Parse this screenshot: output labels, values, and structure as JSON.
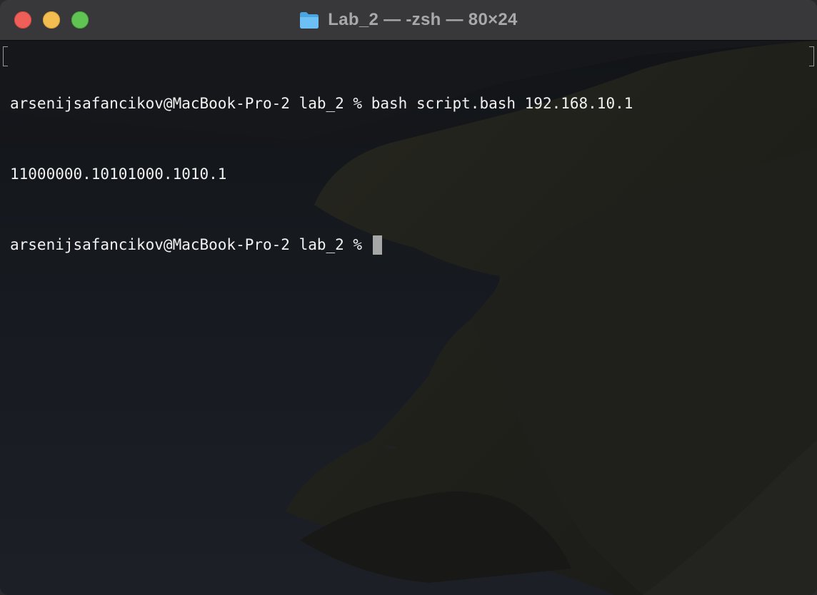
{
  "window": {
    "title": "Lab_2 — -zsh — 80×24",
    "title_icon": "folder-icon",
    "buttons": {
      "close": "close-button",
      "minimize": "minimize-button",
      "zoom": "zoom-button"
    }
  },
  "terminal": {
    "lines": [
      {
        "prompt": "arsenijsafancikov@MacBook-Pro-2 lab_2 % ",
        "text": "bash script.bash 192.168.10.1"
      },
      {
        "prompt": "",
        "text": "11000000.10101000.1010.1"
      },
      {
        "prompt": "arsenijsafancikov@MacBook-Pro-2 lab_2 % ",
        "text": ""
      }
    ]
  },
  "colors": {
    "titlebar": "#38383a",
    "text": "#f2f2f2",
    "close": "#ee5f57",
    "minimize": "#f4bd4f",
    "zoom": "#60c453",
    "folder": "#59b4ec"
  }
}
